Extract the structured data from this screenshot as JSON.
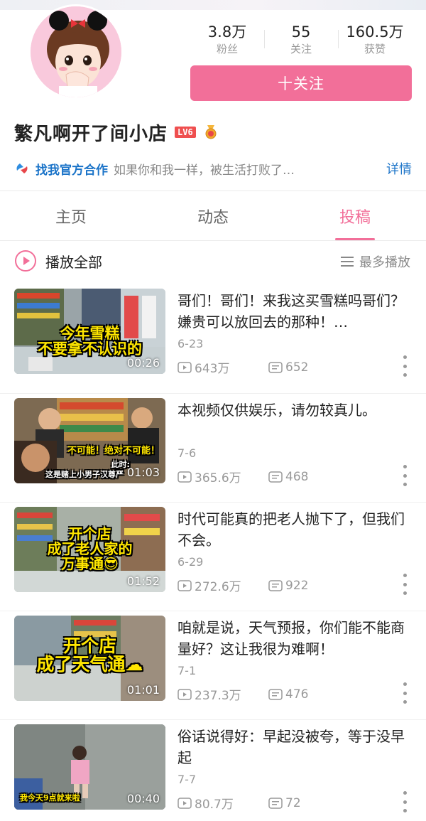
{
  "profile": {
    "stats": [
      {
        "value": "3.8万",
        "label": "粉丝"
      },
      {
        "value": "55",
        "label": "关注"
      },
      {
        "value": "160.5万",
        "label": "获赞"
      }
    ],
    "follow_label": "十关注",
    "name": "繁凡啊开了间小店",
    "level": "LV6",
    "coop_link": "找我官方合作",
    "coop_desc": "如果你和我一样，被生活打败了…",
    "detail_label": "详情"
  },
  "tabs": [
    {
      "label": "主页",
      "active": false
    },
    {
      "label": "动态",
      "active": false
    },
    {
      "label": "投稿",
      "active": true
    }
  ],
  "playbar": {
    "play_all": "播放全部",
    "sort_label": "最多播放"
  },
  "colors": {
    "accent": "#f26f99",
    "link": "#1a73c8",
    "caption": "#ffe600"
  },
  "videos": [
    {
      "title": "哥们！哥们！来我这买雪糕吗哥们？嫌贵可以放回去的那种！…",
      "date": "6-23",
      "views": "643万",
      "comments": "652",
      "duration": "00:26",
      "caption_lines": [
        "今年雪糕",
        "不要拿不认识的"
      ]
    },
    {
      "title": "本视频仅供娱乐，请勿较真儿。",
      "date": "7-6",
      "views": "365.6万",
      "comments": "468",
      "duration": "01:03",
      "caption_lines": [
        "不可能！绝对不可能！",
        "此时:",
        "这是赌上小男子汉尊严"
      ]
    },
    {
      "title": "时代可能真的把老人抛下了，但我们不会。",
      "date": "6-29",
      "views": "272.6万",
      "comments": "922",
      "duration": "01:52",
      "caption_lines": [
        "开个店",
        "成了老人家的",
        "万事通😎"
      ]
    },
    {
      "title": "咱就是说，天气预报，你们能不能商量好？这让我很为难啊！",
      "date": "7-1",
      "views": "237.3万",
      "comments": "476",
      "duration": "01:01",
      "caption_lines": [
        "开个店",
        "成了天气通☁"
      ]
    },
    {
      "title": "俗话说得好：早起没被夸，等于没早起",
      "date": "7-7",
      "views": "80.7万",
      "comments": "72",
      "duration": "00:40",
      "caption_lines": [
        "我今天9点就来啦"
      ]
    }
  ]
}
